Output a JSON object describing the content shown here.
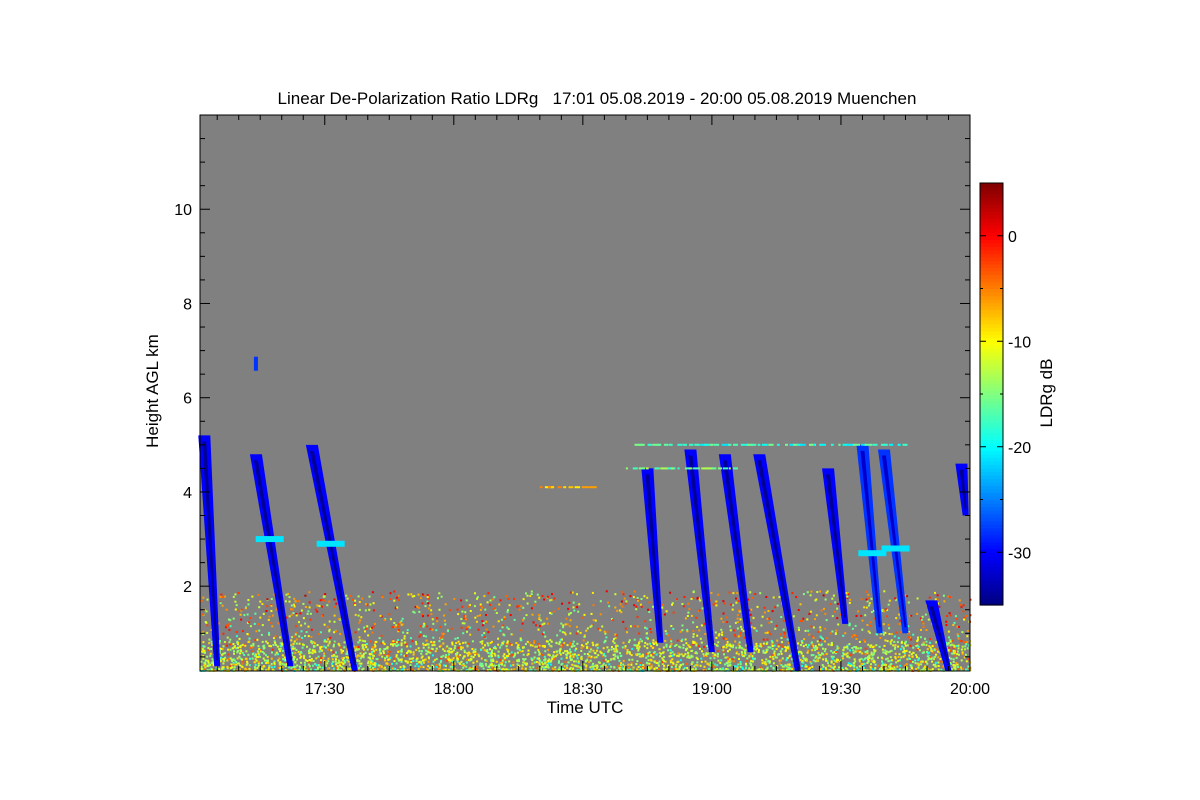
{
  "chart_data": {
    "type": "heatmap",
    "title": "Linear De-Polarization Ratio LDRg   17:01 05.08.2019 - 20:00 05.08.2019 Muenchen",
    "xlabel": "Time UTC",
    "ylabel": "Height AGL km",
    "x_axis": {
      "unit": "minutes",
      "range": [
        "17:01",
        "20:00"
      ],
      "ticks": [
        "17:30",
        "18:00",
        "18:30",
        "19:00",
        "19:30",
        "20:00"
      ]
    },
    "y_axis": {
      "unit": "km",
      "range": [
        0.2,
        12.0
      ],
      "ticks": [
        "2",
        "4",
        "6",
        "8",
        "10"
      ]
    },
    "colorbar": {
      "label": "LDRg dB",
      "range": [
        -35,
        5
      ],
      "ticks": [
        "0",
        "-10",
        "-20",
        "-30"
      ],
      "colormap": "jet"
    },
    "colors": {
      "no_signal": "#808080",
      "plot_frame": "#000000"
    },
    "features": [
      {
        "kind": "boundary_layer",
        "t_start": "17:01",
        "t_end": "20:00",
        "height_top_km": 1.9,
        "ldr_db": -12
      },
      {
        "kind": "fall_streak",
        "t": "17:02",
        "top_km": 5.2,
        "bottom_km": 0.3,
        "slant_min": 3,
        "ldr_db": -30
      },
      {
        "kind": "fall_streak",
        "t": "17:14",
        "top_km": 4.8,
        "bottom_km": 0.3,
        "slant_min": 8,
        "ldr_db": -30,
        "bright_band_km": 3.0
      },
      {
        "kind": "fall_streak",
        "t": "17:27",
        "top_km": 5.0,
        "bottom_km": 0.2,
        "slant_min": 10,
        "ldr_db": -30,
        "bright_band_km": 2.9
      },
      {
        "kind": "fall_streak",
        "t": "18:45",
        "top_km": 4.5,
        "bottom_km": 0.8,
        "slant_min": 3,
        "ldr_db": -30
      },
      {
        "kind": "fall_streak",
        "t": "18:55",
        "top_km": 4.9,
        "bottom_km": 0.6,
        "slant_min": 5,
        "ldr_db": -30
      },
      {
        "kind": "fall_streak",
        "t": "19:03",
        "top_km": 4.8,
        "bottom_km": 0.6,
        "slant_min": 6,
        "ldr_db": -30
      },
      {
        "kind": "fall_streak",
        "t": "19:11",
        "top_km": 4.8,
        "bottom_km": 0.2,
        "slant_min": 9,
        "ldr_db": -30
      },
      {
        "kind": "fall_streak",
        "t": "19:27",
        "top_km": 4.5,
        "bottom_km": 1.2,
        "slant_min": 4,
        "ldr_db": -30
      },
      {
        "kind": "fall_streak",
        "t": "19:35",
        "top_km": 5.0,
        "bottom_km": 1.0,
        "slant_min": 4,
        "ldr_db": -28,
        "bright_band_km": 2.7
      },
      {
        "kind": "fall_streak",
        "t": "19:40",
        "top_km": 4.9,
        "bottom_km": 1.0,
        "slant_min": 5,
        "ldr_db": -28,
        "bright_band_km": 2.8
      },
      {
        "kind": "fall_streak",
        "t": "19:51",
        "top_km": 1.7,
        "bottom_km": 0.2,
        "slant_min": 4,
        "ldr_db": -30
      },
      {
        "kind": "fall_streak",
        "t": "19:58",
        "top_km": 4.6,
        "bottom_km": 3.5,
        "slant_min": 1,
        "ldr_db": -30
      },
      {
        "kind": "elevated_patch",
        "t": "17:14",
        "height_km": 6.7,
        "ldr_db": -28
      },
      {
        "kind": "thin_layer",
        "t_start": "18:42",
        "t_end": "19:45",
        "height_km": 5.0,
        "ldr_db": -18
      },
      {
        "kind": "thin_layer",
        "t_start": "18:40",
        "t_end": "19:05",
        "height_km": 4.5,
        "ldr_db": -15
      },
      {
        "kind": "thin_layer",
        "t_start": "18:20",
        "t_end": "18:32",
        "height_km": 4.1,
        "ldr_db": -8
      }
    ]
  }
}
